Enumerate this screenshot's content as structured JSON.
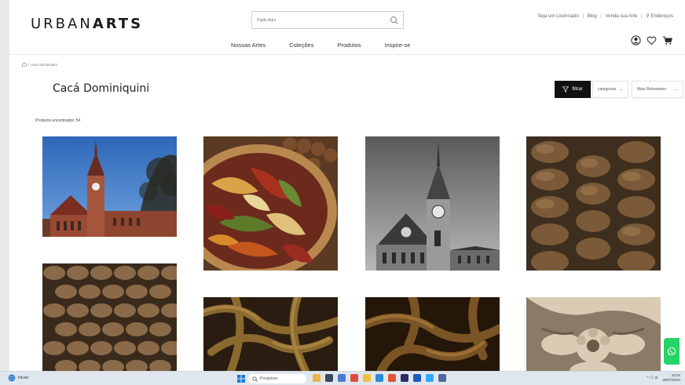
{
  "header": {
    "logo_light": "URBAN",
    "logo_bold": "ARTS",
    "search_placeholder": "Digite Aqui",
    "top_links": [
      "Seja um Licenciado",
      "Blog",
      "Venda sua Arte",
      "Endereços"
    ],
    "nav": [
      "Nossas Artes",
      "Coleções",
      "Produtos",
      "Inspire-se"
    ]
  },
  "breadcrumb": {
    "separator": "/",
    "current": "caca dominiquini"
  },
  "page": {
    "title": "Cacá Dominiquini",
    "filter_label": "filtrar",
    "category_select": "categorias",
    "sort_select": "Mais Relevantes",
    "found_text": "Produtos encontrados: 54"
  },
  "products": [
    {
      "image": "church-color"
    },
    {
      "image": "dried-leaves-bowl"
    },
    {
      "image": "church-bw"
    },
    {
      "image": "cable-knit"
    },
    {
      "image": "woven-rope"
    },
    {
      "image": "wood-roots"
    },
    {
      "image": "wood-roots-dark"
    },
    {
      "image": "carved-ornament"
    }
  ],
  "taskbar": {
    "start_label": "Iniciar",
    "search_label": "Pesquisar",
    "time": "10:34",
    "date": "26/07/2024",
    "tray_text": "^ 🗨 ⊡"
  },
  "colors": {
    "accent_black": "#111111",
    "whatsapp": "#25d366"
  }
}
